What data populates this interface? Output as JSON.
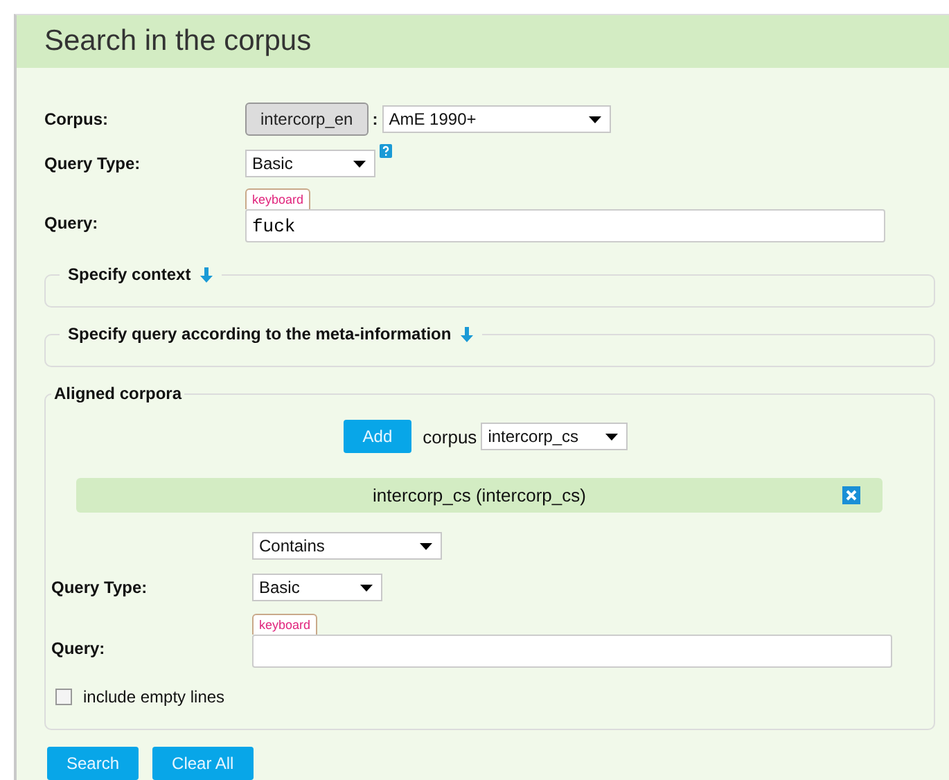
{
  "header": {
    "title": "Search in the corpus"
  },
  "corpus": {
    "label": "Corpus:",
    "button": "intercorp_en",
    "separator": ":",
    "subcorpus": "AmE 1990+"
  },
  "query_type": {
    "label": "Query Type:",
    "value": "Basic"
  },
  "query": {
    "label": "Query:",
    "keyboard": "keyboard",
    "value": "fuck"
  },
  "sections": [
    {
      "title": "Specify context"
    },
    {
      "title": "Specify query according to the meta-information"
    }
  ],
  "aligned": {
    "title": "Aligned corpora",
    "add_button": "Add",
    "corpus_label": "corpus",
    "corpus_value": "intercorp_cs",
    "items": [
      {
        "name": "intercorp_cs (intercorp_cs)",
        "match": "Contains",
        "query_type_label": "Query Type:",
        "query_type": "Basic",
        "query_label": "Query:",
        "keyboard": "keyboard",
        "include_empty": {
          "label": "include empty lines",
          "checked": false
        }
      }
    ]
  },
  "buttons": [
    "Search",
    "Clear All"
  ]
}
